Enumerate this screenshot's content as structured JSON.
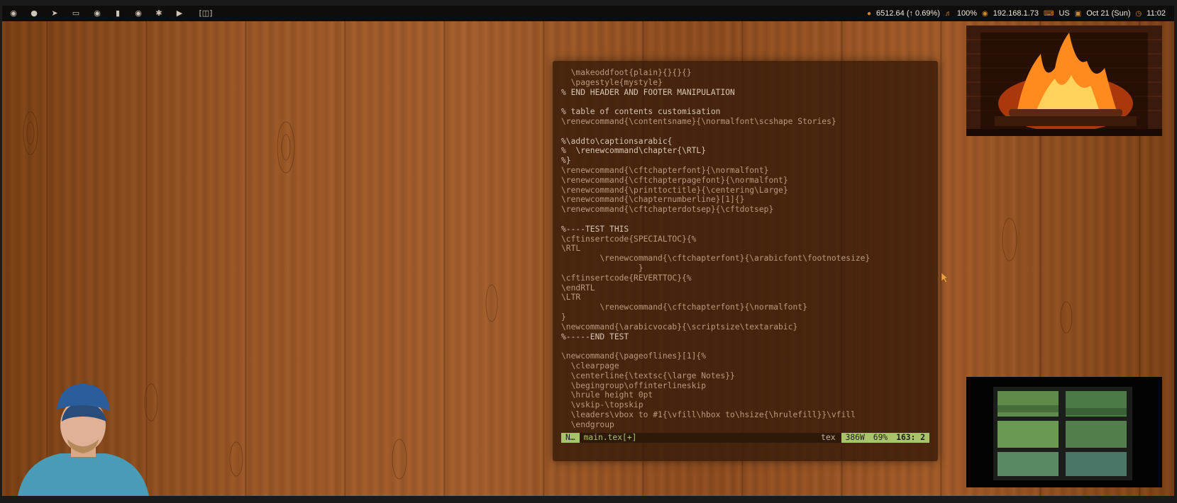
{
  "topbar": {
    "left_icons": [
      "menu-logo-icon",
      "firefox-icon",
      "telegram-icon",
      "drive-icon",
      "palette-icon",
      "microphone-icon",
      "github-icon",
      "slack-icon",
      "youtube-icon",
      "windows-icon"
    ],
    "status": {
      "btc": "6512.64 (↑ 0.69%)",
      "volume": "100%",
      "ip": "192.168.1.73",
      "kbd": "US",
      "date": "Oct 21 (Sun)",
      "time": "11:02"
    }
  },
  "editor": {
    "lines": [
      "  \\makeoddfoot{plain}{}{}{}",
      "  \\pagestyle{mystyle}",
      "% END HEADER AND FOOTER MANIPULATION",
      "",
      "% table of contents customisation",
      "\\renewcommand{\\contentsname}{\\normalfont\\scshape Stories}",
      "",
      "%\\addto\\captionsarabic{",
      "%  \\renewcommand\\chapter{\\RTL}",
      "%}",
      "\\renewcommand{\\cftchapterfont}{\\normalfont}",
      "\\renewcommand{\\cftchapterpagefont}{\\normalfont}",
      "\\renewcommand{\\printtoctitle}{\\centering\\Large}",
      "\\renewcommand{\\chapternumberline}[1]{}",
      "\\renewcommand{\\cftchapterdotsep}{\\cftdotsep}",
      "",
      "%----TEST THIS",
      "\\cftinsertcode{SPECIALTOC}{%",
      "\\RTL",
      "        \\renewcommand{\\cftchapterfont}{\\arabicfont\\footnotesize}",
      "                }",
      "\\cftinsertcode{REVERTTOC}{%",
      "\\endRTL",
      "\\LTR",
      "        \\renewcommand{\\cftchapterfont}{\\normalfont}",
      "}",
      "\\newcommand{\\arabicvocab}{\\scriptsize\\textarabic}",
      "%-----END TEST",
      "",
      "\\newcommand{\\pageoflines}[1]{%",
      "  \\clearpage",
      "  \\centerline{\\textsc{\\large Notes}}",
      "  \\begingroup\\offinterlineskip",
      "  \\hrule height 0pt",
      "  \\vskip-\\topskip",
      "  \\leaders\\vbox to #1{\\vfill\\hbox to\\hsize{\\hrulefill}}\\vfill",
      "  \\endgroup"
    ],
    "statusline": {
      "mode": "N…",
      "file": "main.tex[+]",
      "filetype": "tex",
      "words": "386W",
      "percent": "69%",
      "position": "163:  2"
    }
  }
}
